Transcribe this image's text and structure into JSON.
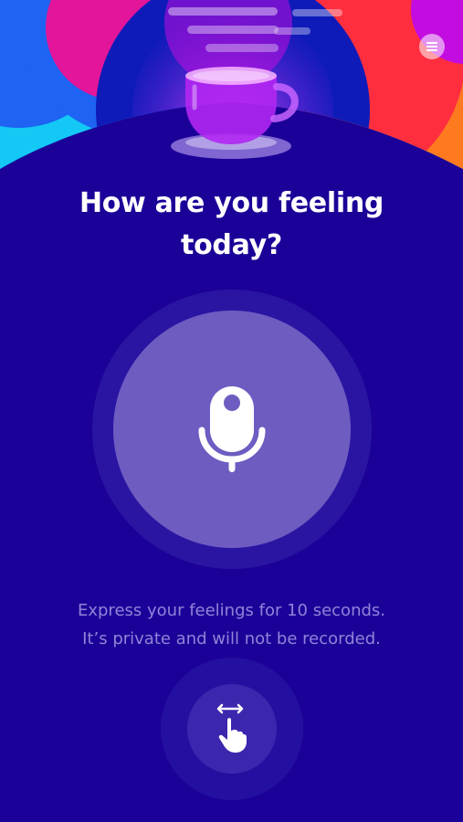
{
  "theme": {
    "background": "#1C0198",
    "mic_button_color": "#6E5CC1",
    "text_secondary": "#8F84D9",
    "header_colors": [
      "#13C8F5",
      "#1E63F2",
      "#E3159A",
      "#FF2E3F",
      "#FF7A1F",
      "#FFC21A",
      "#C30CE0"
    ]
  },
  "header": {
    "illustration": "coffee-cup-icon",
    "menu_icon": "hamburger-menu-icon"
  },
  "title": {
    "line1": "How are you feeling",
    "line2": "today?"
  },
  "mic": {
    "icon": "microphone-icon"
  },
  "description": {
    "line1": "Express your feelings for 10 seconds.",
    "line2": "It’s private and will not be recorded."
  },
  "gesture": {
    "icon": "swipe-hand-icon"
  }
}
